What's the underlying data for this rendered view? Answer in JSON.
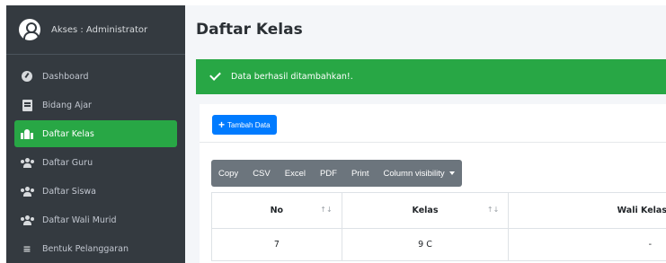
{
  "sidebar": {
    "brand_text": "Akses : Administrator",
    "items": [
      {
        "label": "Dashboard",
        "icon": "dashboard-icon"
      },
      {
        "label": "Bidang Ajar",
        "icon": "book-icon"
      },
      {
        "label": "Daftar Kelas",
        "icon": "school-icon",
        "active": true
      },
      {
        "label": "Daftar Guru",
        "icon": "users-icon"
      },
      {
        "label": "Daftar Siswa",
        "icon": "users-icon"
      },
      {
        "label": "Daftar Wali Murid",
        "icon": "users-icon"
      },
      {
        "label": "Bentuk Pelanggaran",
        "icon": "list-icon"
      }
    ]
  },
  "main": {
    "page_title": "Daftar Kelas",
    "alert_text": "Data berhasil ditambahkan!.",
    "add_button_label": "Tambah Data",
    "export_buttons": [
      "Copy",
      "CSV",
      "Excel",
      "PDF",
      "Print",
      "Column visibility"
    ],
    "table": {
      "headers": [
        "No",
        "Kelas",
        "Wali Kelas"
      ],
      "rows": [
        [
          "7",
          "9 C",
          "-"
        ]
      ]
    }
  },
  "colors": {
    "sidebar_bg": "#343a40",
    "active_green": "#28a745",
    "primary_blue": "#007bff",
    "button_gray": "#6c757d"
  }
}
